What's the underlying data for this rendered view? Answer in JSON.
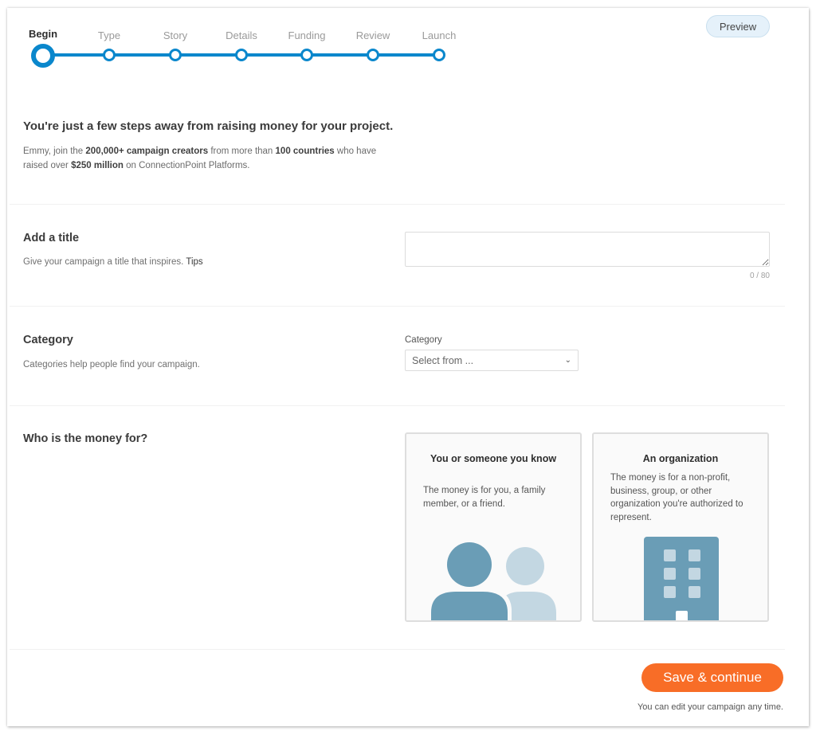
{
  "stepper": {
    "steps": [
      {
        "label": "Begin",
        "active": true
      },
      {
        "label": "Type",
        "active": false
      },
      {
        "label": "Story",
        "active": false
      },
      {
        "label": "Details",
        "active": false
      },
      {
        "label": "Funding",
        "active": false
      },
      {
        "label": "Review",
        "active": false
      },
      {
        "label": "Launch",
        "active": false
      }
    ],
    "accent_color": "#0a87cc"
  },
  "header": {
    "preview_label": "Preview"
  },
  "intro": {
    "title": "You're just a few steps away from raising money for your project.",
    "text_parts": {
      "p1": "Emmy, join the ",
      "b1": "200,000+ campaign creators",
      "p2": " from more than ",
      "b2": "100 countries",
      "p3": " who have raised over ",
      "b3": "$250 million",
      "p4": " on ConnectionPoint Platforms."
    }
  },
  "title_section": {
    "heading": "Add a title",
    "description": "Give your campaign a title that inspires.",
    "tips_link": "Tips",
    "input_value": "",
    "counter": "0 / 80"
  },
  "category_section": {
    "heading": "Category",
    "description": "Categories help people find your campaign.",
    "field_label": "Category",
    "select_value": "Select from ..."
  },
  "recipient_section": {
    "heading": "Who is the money for?",
    "options": [
      {
        "title": "You or someone you know",
        "description": "The money is for you, a family member, or a friend.",
        "icon": "people-icon"
      },
      {
        "title": "An organization",
        "description": "The money is for a non-profit, business, group, or other organization you're authorized to represent.",
        "icon": "building-icon"
      }
    ]
  },
  "footer": {
    "save_label": "Save & continue",
    "note": "You can edit your campaign any time.",
    "button_color": "#f86d27"
  }
}
